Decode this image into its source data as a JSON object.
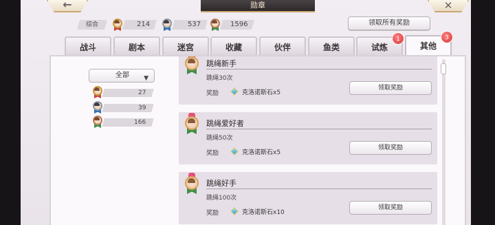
{
  "header": {
    "title": "勋章",
    "back_icon": "←",
    "close_icon": "✕"
  },
  "summary": {
    "label": "综合",
    "gold": 214,
    "silver": 537,
    "bronze": 1596,
    "claim_all_label": "领取所有奖励"
  },
  "tabs": [
    {
      "label": "战斗"
    },
    {
      "label": "剧本"
    },
    {
      "label": "迷宫"
    },
    {
      "label": "收藏"
    },
    {
      "label": "伙伴"
    },
    {
      "label": "鱼类"
    },
    {
      "label": "试炼",
      "badge": "1"
    },
    {
      "label": "其他",
      "badge": "3",
      "active": true
    }
  ],
  "filter": {
    "selected": "全部",
    "arrow": "▼"
  },
  "stats": [
    {
      "medal": "gold",
      "count": 27
    },
    {
      "medal": "silver",
      "count": 39
    },
    {
      "medal": "bronze",
      "count": 166
    }
  ],
  "achievements": [
    {
      "name": "跳绳新手",
      "desc": "跳绳30次",
      "reward_label": "奖励",
      "reward": "克洛诺斯石x5",
      "button": "领取奖励"
    },
    {
      "name": "跳绳爱好者",
      "desc": "跳绳50次",
      "reward_label": "奖励",
      "reward": "克洛诺斯石x5",
      "button": "领取奖励"
    },
    {
      "name": "跳绳好手",
      "desc": "跳绳100次",
      "reward_label": "奖励",
      "reward": "克洛诺斯石x10",
      "button": "领取奖励"
    }
  ],
  "colors": {
    "accent": "#caa66e",
    "badge": "#d63a3a",
    "ribbon": "#3e8f4c"
  }
}
